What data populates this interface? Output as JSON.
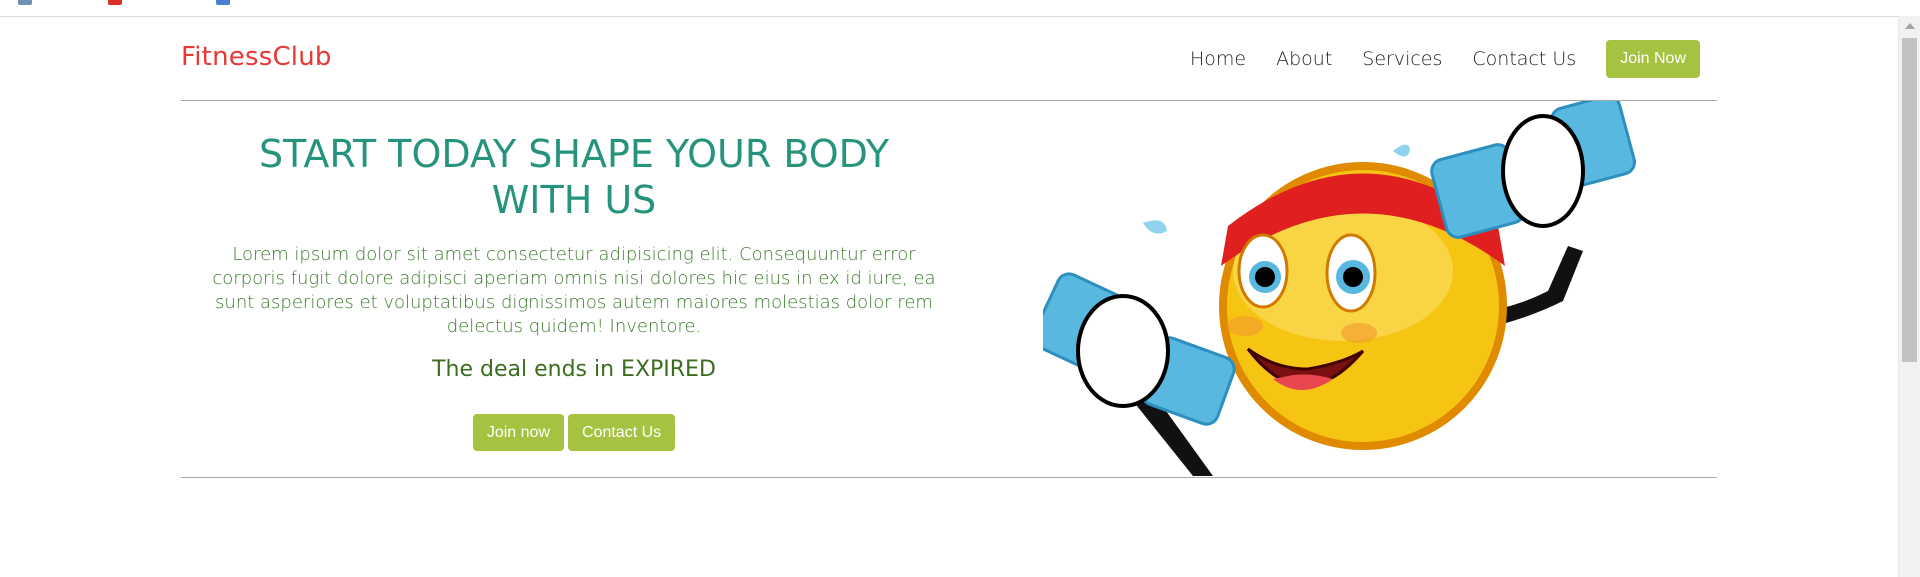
{
  "brand": {
    "name": "FitnessClub"
  },
  "nav": {
    "links": [
      "Home",
      "About",
      "Services",
      "Contact Us"
    ],
    "cta_label": "Join Now"
  },
  "hero": {
    "headline": "START TODAY SHAPE YOUR BODY WITH US",
    "description": "Lorem ipsum dolor sit amet consectetur adipisicing elit. Consequuntur error corporis fugit dolore adipisci aperiam omnis nisi dolores hic eius in ex id iure, ea sunt asperiores et voluptatibus dignissimos autem maiores molestias dolor rem delectus quidem! Inventore.",
    "deal_text": "The deal ends in EXPIRED",
    "buttons": {
      "join_label": "Join now",
      "contact_label": "Contact Us"
    },
    "image_icon": "emoji-dumbbells-illustration"
  },
  "colors": {
    "brand": "#e53935",
    "button": "#a5c240",
    "headline": "#26937d",
    "body_text": "#3e7a2e",
    "deal_text": "#3b6d1f"
  }
}
